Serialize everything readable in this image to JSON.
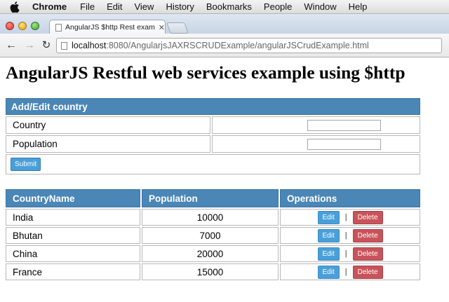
{
  "menubar": {
    "app": "Chrome",
    "items": [
      "File",
      "Edit",
      "View",
      "History",
      "Bookmarks",
      "People",
      "Window",
      "Help"
    ]
  },
  "tab": {
    "title": "AngularJS $http Rest example"
  },
  "toolbar": {
    "url_host": "localhost",
    "url_path": ":8080/AngularjsJAXRSCRUDExample/angularJSCrudExample.html"
  },
  "page": {
    "title": "AngularJS Restful web services example using $http"
  },
  "form": {
    "header": "Add/Edit country",
    "country_label": "Country",
    "population_label": "Population",
    "country_value": "",
    "population_value": "",
    "submit_label": "Submit"
  },
  "table": {
    "headers": [
      "CountryName",
      "Population",
      "Operations"
    ],
    "edit_label": "Edit",
    "delete_label": "Delete",
    "separator": "|",
    "rows": [
      {
        "name": "India",
        "population": "10000"
      },
      {
        "name": "Bhutan",
        "population": "7000"
      },
      {
        "name": "China",
        "population": "20000"
      },
      {
        "name": "France",
        "population": "15000"
      }
    ]
  },
  "colors": {
    "header_blue": "#4a86b6",
    "edit_button": "#4a9fd8",
    "delete_button": "#c9535a"
  }
}
